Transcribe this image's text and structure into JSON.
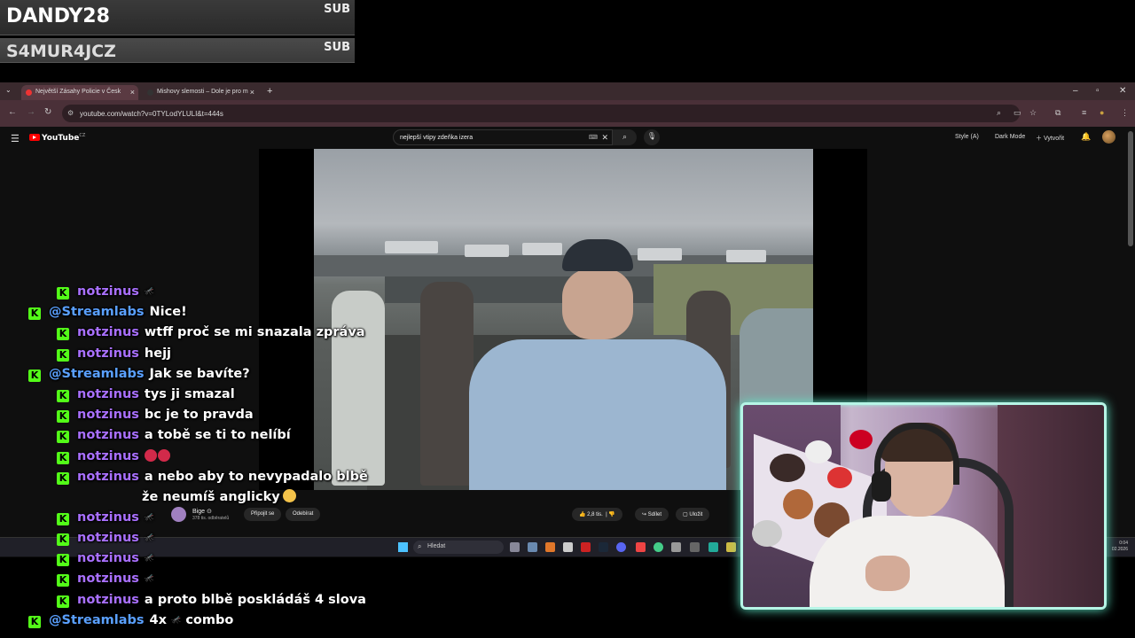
{
  "alerts": [
    {
      "name": "DANDY28",
      "tag": "SUB"
    },
    {
      "name": "S4MUR4JCZ",
      "tag": "SUB"
    }
  ],
  "browser": {
    "tabs": [
      {
        "title": "Největší Zásahy Policie v Česk"
      },
      {
        "title": "Mishovy slemosti – Dole je pro m"
      }
    ],
    "url": "youtube.com/watch?v=0TYLodYLULI&t=444s"
  },
  "youtube": {
    "logo": "YouTube",
    "region": "CZ",
    "search_query": "nejlepší vtipy zdeňka izera",
    "header_links": [
      "Style (A)",
      "Dark Mode",
      "Vytvořit"
    ],
    "channel": {
      "name": "Bige",
      "subs": "378 tis. odběratelů"
    },
    "buttons": {
      "join": "Připojit se",
      "unsubscribe": "Odebírat",
      "likes": "2,8 tis.",
      "share": "Sdílet",
      "save": "Uložit"
    }
  },
  "taskbar": {
    "search": "Hledat",
    "time": "0:04",
    "date": "02.2026"
  },
  "chat": [
    {
      "user": "notzinus",
      "text": "",
      "emote": "mosquito",
      "kind": "viewer"
    },
    {
      "user": "@Streamlabs",
      "text": "Nice!",
      "kind": "bot"
    },
    {
      "user": "notzinus",
      "text": "wtff proč se mi snazala zpráva",
      "kind": "viewer"
    },
    {
      "user": "notzinus",
      "text": "hejj",
      "kind": "viewer"
    },
    {
      "user": "@Streamlabs",
      "text": "Jak se bavíte?",
      "kind": "bot"
    },
    {
      "user": "notzinus",
      "text": "tys ji smazal",
      "kind": "viewer"
    },
    {
      "user": "notzinus",
      "text": "bc je to pravda",
      "kind": "viewer"
    },
    {
      "user": "notzinus",
      "text": "a tobě se ti to nelíbí",
      "kind": "viewer"
    },
    {
      "user": "notzinus",
      "text": "",
      "emote": "angry-faces",
      "kind": "viewer"
    },
    {
      "user": "notzinus",
      "text": "a nebo aby to nevypadalo blbě",
      "text2": "že neumíš anglicky",
      "kind": "viewer"
    },
    {
      "user": "notzinus",
      "text": "",
      "emote": "mosquito",
      "kind": "viewer"
    },
    {
      "user": "notzinus",
      "text": "",
      "emote": "mosquito",
      "kind": "viewer"
    },
    {
      "user": "notzinus",
      "text": "",
      "emote": "mosquito",
      "kind": "viewer"
    },
    {
      "user": "notzinus",
      "text": "",
      "emote": "mosquito",
      "kind": "viewer"
    },
    {
      "user": "notzinus",
      "text": "a proto blbě poskládáš 4 slova",
      "kind": "viewer"
    },
    {
      "user": "@Streamlabs",
      "text": "4x",
      "text3": "combo",
      "emote": "mosquito",
      "kind": "bot"
    }
  ],
  "colors": {
    "kick_green": "#53fc18",
    "viewer_name": "#a970ff",
    "bot_name": "#5aa0ff",
    "cam_border": "#b6f5e6"
  }
}
